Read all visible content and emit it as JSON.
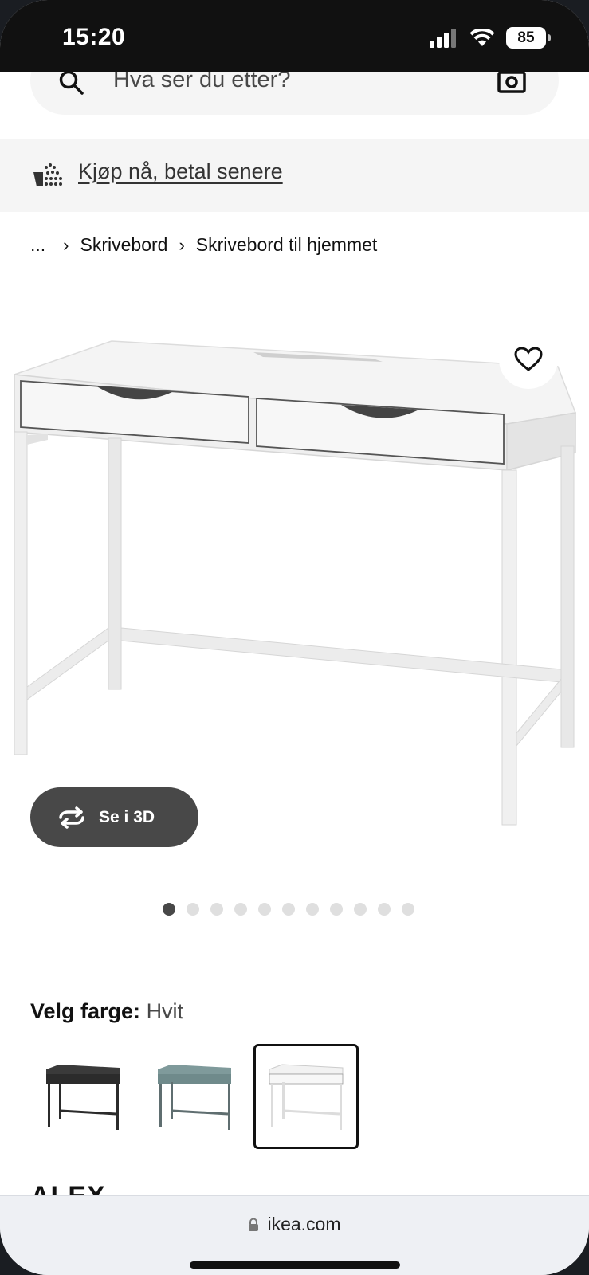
{
  "status": {
    "time": "15:20",
    "battery": "85"
  },
  "search": {
    "placeholder": "Hva ser du etter?"
  },
  "promo": {
    "link": "Kjøp nå, betal senere"
  },
  "breadcrumb": {
    "ellipsis": "...",
    "items": [
      "Skrivebord",
      "Skrivebord til hjemmet"
    ]
  },
  "viewer": {
    "button_3d": "Se i 3D",
    "dot_count": 11,
    "active_dot": 1
  },
  "color": {
    "label": "Velg farge:",
    "value": "Hvit",
    "options": [
      "black-brown",
      "grey-turquoise",
      "white"
    ],
    "selected_index": 2
  },
  "product": {
    "name": "ALEX"
  },
  "browser": {
    "url": "ikea.com"
  },
  "icons": [
    "search-icon",
    "camera-icon",
    "payment-icon",
    "heart-icon",
    "rotate-3d-icon",
    "lock-icon",
    "wifi-icon",
    "signal-icon"
  ],
  "colors": {
    "button_dark": "#484848",
    "banner_bg": "#f5f5f5",
    "status_bar": "#111111"
  }
}
